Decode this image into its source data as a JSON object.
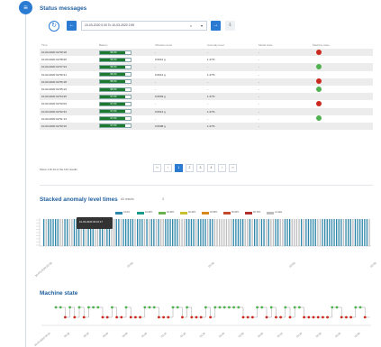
{
  "colors": {
    "accent": "#2b7bd3",
    "good": "#1c7a2f",
    "alarm": "#cc2a1e",
    "ok": "#4fb24f"
  },
  "rail": {
    "icon": "list-icon"
  },
  "status": {
    "title": "Status messages",
    "date_range": "10-03-2020 0.00 To 10-03-2020 2.59",
    "columns": [
      "Time",
      "Battery",
      "Vibration level",
      "Anomaly level",
      "Model state",
      "Machine state"
    ],
    "rows": [
      {
        "time": "10-03-2020 02:59:18",
        "battery": "98.3%",
        "vibration": "-",
        "anomaly": "-",
        "model": "-",
        "machine": "alarm"
      },
      {
        "time": "10-03-2020 02:58:26",
        "battery": "98.3%",
        "vibration": "0.0612 g",
        "anomaly": "1.27%",
        "model": "-",
        "machine": ""
      },
      {
        "time": "10-03-2020 02:57:23",
        "battery": "98.3%",
        "vibration": "-",
        "anomaly": "-",
        "model": "-",
        "machine": "ok"
      },
      {
        "time": "10-03-2020 02:56:31",
        "battery": "98.3%",
        "vibration": "0.0614 g",
        "anomaly": "1.27%",
        "model": "-",
        "machine": ""
      },
      {
        "time": "10-03-2020 02:56:18",
        "battery": "98.3%",
        "vibration": "-",
        "anomaly": "-",
        "model": "-",
        "machine": "alarm"
      },
      {
        "time": "10-03-2020 02:55:19",
        "battery": "98.3%",
        "vibration": "-",
        "anomaly": "-",
        "model": "-",
        "machine": "ok"
      },
      {
        "time": "10-03-2020 02:54:25",
        "battery": "97.3%",
        "vibration": "0.0603 g",
        "anomaly": "1.27%",
        "model": "-",
        "machine": ""
      },
      {
        "time": "10-03-2020 02:53:09",
        "battery": "97.3%",
        "vibration": "-",
        "anomaly": "-",
        "model": "-",
        "machine": "alarm"
      },
      {
        "time": "10-03-2020 02:52:34",
        "battery": "97.3%",
        "vibration": "0.0614 g",
        "anomaly": "1.27%",
        "model": "-",
        "machine": ""
      },
      {
        "time": "10-03-2020 02:51:13",
        "battery": "97.3%",
        "vibration": "-",
        "anomaly": "-",
        "model": "-",
        "machine": "ok"
      },
      {
        "time": "10-03-2020 02:50:16",
        "battery": "97.3%",
        "vibration": "0.0608 g",
        "anomaly": "1.27%",
        "model": "-",
        "machine": ""
      }
    ],
    "battery_levels": [
      0.983,
      0.983,
      0.983,
      0.983,
      0.983,
      0.983,
      0.973,
      0.973,
      0.973,
      0.973,
      0.973
    ],
    "footer": "Show 1 till 10 of the 144 results",
    "pager": [
      "‹‹",
      "‹",
      "1",
      "2",
      "3",
      "4",
      "›",
      "››"
    ],
    "pager_active": 2
  },
  "anomaly": {
    "title": "Stacked anomaly level times",
    "filter_label": "All results",
    "filter_value": "3",
    "tooltip": "10-03-2020 02:10:17",
    "legend": [
      {
        "label": "0-10%",
        "color": "#2e86a8"
      },
      {
        "label": "10-20%",
        "color": "#1a9a8a"
      },
      {
        "label": "20-30%",
        "color": "#6ab04c"
      },
      {
        "label": "30-40%",
        "color": "#c9c031"
      },
      {
        "label": "40-50%",
        "color": "#d68a1e"
      },
      {
        "label": "50-60%",
        "color": "#c24a2a"
      },
      {
        "label": "60-70%",
        "color": "#b03030"
      },
      {
        "label": "no data",
        "color": "#bdbdbd"
      }
    ],
    "x_ticks": [
      "10-03-2020 00:30",
      "01:00",
      "01:30",
      "02:00",
      "02:30"
    ]
  },
  "machine": {
    "title": "Machine state",
    "x_ticks": [
      "10-03-2020 00:10",
      "00:20",
      "00:30",
      "00:40",
      "00:50",
      "01:00",
      "01:10",
      "01:20",
      "01:30",
      "01:40",
      "01:50",
      "02:00",
      "02:10",
      "02:20",
      "02:30",
      "02:40",
      "02:50"
    ]
  }
}
